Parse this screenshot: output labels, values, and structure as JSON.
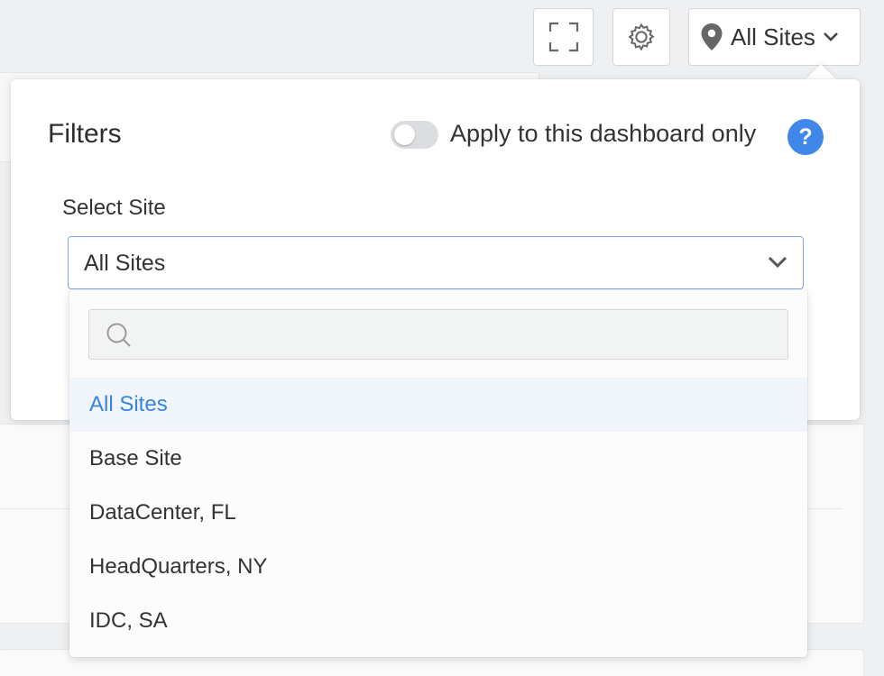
{
  "toolbar": {
    "fullscreen_icon": "fullscreen-icon",
    "settings_icon": "gear-icon",
    "site_icon": "map-pin-icon",
    "site_label": "All Sites"
  },
  "filters": {
    "title": "Filters",
    "apply_toggle_on": false,
    "apply_label": "Apply to this dashboard only",
    "help_label": "?",
    "select_site_label": "Select Site",
    "selected_site": "All Sites",
    "search_value": "",
    "options": [
      {
        "label": "All Sites",
        "selected": true
      },
      {
        "label": "Base Site",
        "selected": false
      },
      {
        "label": "DataCenter, FL",
        "selected": false
      },
      {
        "label": "HeadQuarters, NY",
        "selected": false
      },
      {
        "label": "IDC, SA",
        "selected": false
      }
    ]
  },
  "colors": {
    "accent": "#3f87e8",
    "selected_text": "#3a83e0",
    "selected_bg": "#eff5fb"
  }
}
